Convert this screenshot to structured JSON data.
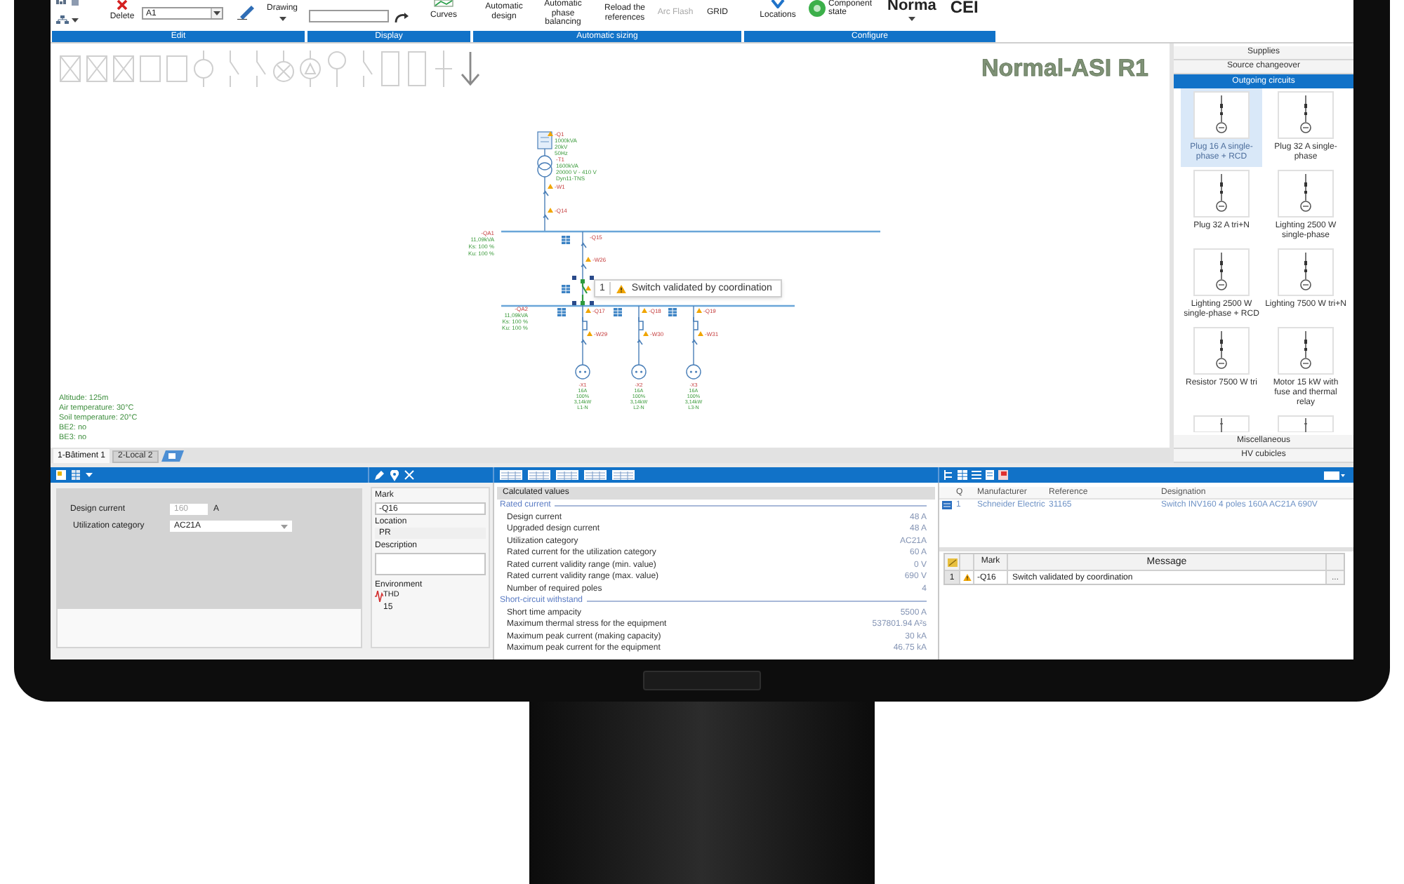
{
  "ribbon": {
    "edit": {
      "label": "Edit",
      "delete": "Delete",
      "mark_field": "A1",
      "drawing": "Drawing"
    },
    "display": {
      "label": "Display",
      "curves": "Curves"
    },
    "automatic_sizing": {
      "label": "Automatic sizing",
      "buttons": [
        {
          "label": "Automatic design",
          "disabled": false
        },
        {
          "label": "Automatic phase balancing",
          "disabled": false
        },
        {
          "label": "Reload the references",
          "disabled": false
        },
        {
          "label": "Arc Flash",
          "disabled": true
        },
        {
          "label": "GRID",
          "disabled": false
        }
      ]
    },
    "configure": {
      "label": "Configure",
      "locations": "Locations",
      "component_state": "Component state",
      "standard": "Norma",
      "standard_code": "CEI"
    }
  },
  "canvas": {
    "title": "Normal-ASI R1",
    "diagram": {
      "source": {
        "mark": "-Q1",
        "warning": true,
        "ratings": [
          "1000kVA",
          "20kV",
          "50Hz"
        ]
      },
      "transformer": {
        "mark": "-T1",
        "ratings": [
          "1600kVA",
          "20000 V - 410 V",
          "Dyn11-TNS"
        ]
      },
      "incomer": [
        {
          "mark": "-W1",
          "warning": true
        },
        {
          "mark": "-Q14",
          "warning": true
        }
      ],
      "busbars": [
        {
          "mark": "-QA1",
          "ratings": [
            "11,09kVA",
            "Ks: 100 %",
            "Ku: 100 %"
          ]
        },
        {
          "mark": "-QA2",
          "ratings": [
            "11,09kVA",
            "Ks: 100 %",
            "Ku: 100 %"
          ]
        }
      ],
      "link": {
        "marks": [
          {
            "mark": "-Q15",
            "warning": false
          },
          {
            "mark": "-W26",
            "warning": true
          }
        ],
        "switch": {
          "selected": true,
          "warning": true
        }
      },
      "outgoing": [
        {
          "breaker": {
            "mark": "-Q17",
            "warning": true
          },
          "cable": {
            "mark": "-W29",
            "warning": true
          },
          "load": [
            "-X1",
            "16A",
            "100%",
            "3,14kW",
            "L1-N"
          ]
        },
        {
          "breaker": {
            "mark": "-Q18",
            "warning": true
          },
          "cable": {
            "mark": "-W30",
            "warning": true
          },
          "load": [
            "-X2",
            "16A",
            "100%",
            "3,14kW",
            "L2-N"
          ]
        },
        {
          "breaker": {
            "mark": "-Q19",
            "warning": true
          },
          "cable": {
            "mark": "-W31",
            "warning": true
          },
          "load": [
            "-X3",
            "16A",
            "100%",
            "3,14kW",
            "L3-N"
          ]
        }
      ]
    },
    "tooltip": {
      "count": "1",
      "message": "Switch validated by coordination"
    },
    "environment": [
      "Altitude: 125m",
      "Air temperature: 30°C",
      "Soil temperature: 20°C",
      "BE2: no",
      "BE3: no"
    ],
    "tabs": [
      {
        "label": "1-Bâtiment 1",
        "selected": true
      },
      {
        "label": "2-Local 2",
        "selected": false
      }
    ]
  },
  "palette": {
    "sections_top": [
      {
        "label": "Supplies",
        "selected": false
      },
      {
        "label": "Source changeover",
        "selected": false
      },
      {
        "label": "Outgoing circuits",
        "selected": true
      }
    ],
    "items": [
      {
        "label": "Plug 16 A single-phase + RCD",
        "selected": true
      },
      {
        "label": "Plug 32 A single-phase",
        "selected": false
      },
      {
        "label": "Plug 32 A tri+N",
        "selected": false
      },
      {
        "label": "Lighting 2500 W single-phase",
        "selected": false
      },
      {
        "label": "Lighting 2500 W single-phase + RCD",
        "selected": false
      },
      {
        "label": "Lighting 7500 W tri+N",
        "selected": false
      },
      {
        "label": "Resistor 7500 W tri",
        "selected": false
      },
      {
        "label": "Motor 15 kW with fuse and thermal relay",
        "selected": false
      },
      {
        "selected": false
      },
      {
        "selected": false
      }
    ],
    "sections_bottom": [
      {
        "label": "Miscellaneous",
        "selected": false
      },
      {
        "label": "HV cubicles",
        "selected": false
      }
    ]
  },
  "load_settings": {
    "design_current": {
      "label": "Design current",
      "value": "160",
      "unit": "A",
      "disabled": true
    },
    "utilization_category": {
      "label": "Utilization category",
      "value": "AC21A"
    }
  },
  "properties": {
    "mark": {
      "label": "Mark",
      "value": "-Q16"
    },
    "location": {
      "label": "Location",
      "value": "PR"
    },
    "description": {
      "label": "Description"
    },
    "environment": {
      "label": "Environment",
      "thd_label": "THD",
      "thd_value": "15"
    }
  },
  "calculated_values": {
    "title": "Calculated values",
    "groups": [
      {
        "label": "Rated current",
        "rows": [
          {
            "name": "Design current",
            "value": "48 A"
          },
          {
            "name": "Upgraded design current",
            "value": "48 A"
          },
          {
            "name": "Utilization category",
            "value": "AC21A"
          },
          {
            "name": "Rated current for the utilization category",
            "value": "60 A"
          },
          {
            "name": "Rated current validity range (min. value)",
            "value": "0 V"
          },
          {
            "name": "Rated current validity range (max. value)",
            "value": "690 V"
          },
          {
            "name": "Number of required poles",
            "value": "4"
          }
        ]
      },
      {
        "label": "Short-circuit withstand",
        "rows": [
          {
            "name": "Short time ampacity",
            "value": "5500 A"
          },
          {
            "name": "Maximum thermal stress for the equipment",
            "value": "537801.94 A²s"
          },
          {
            "name": "Maximum peak current (making capacity)",
            "value": "30 kA"
          },
          {
            "name": "Maximum peak current for the equipment",
            "value": "46.75 kA"
          }
        ]
      }
    ]
  },
  "references": {
    "columns": [
      "Q",
      "Manufacturer",
      "Reference",
      "Designation"
    ],
    "rows": [
      {
        "cells": [
          "1",
          "Schneider Electric",
          "31165",
          "Switch INV160 4 poles 160A AC21A 690V"
        ]
      }
    ]
  },
  "messages": {
    "columns": [
      "Mark",
      "Message"
    ],
    "rows": [
      {
        "index": "1",
        "kind": "warning",
        "mark": "-Q16",
        "message": "Switch validated by coordination",
        "action": "..."
      }
    ]
  }
}
